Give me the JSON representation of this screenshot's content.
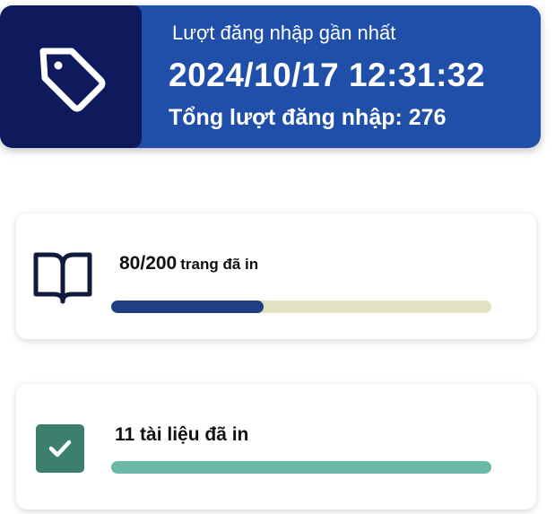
{
  "login": {
    "title": "Lượt đăng nhập gần nhất",
    "datetime": "2024/10/17 12:31:32",
    "count_text": "Tổng lượt đăng nhập: 276",
    "icon": "tag-icon"
  },
  "pages": {
    "value": "80/200",
    "unit": "trang đã in",
    "printed": 80,
    "total": 200,
    "icon": "book-icon"
  },
  "documents": {
    "text": "11 tài liệu đã in",
    "icon": "checkbox-icon"
  },
  "colors": {
    "header_bg": "#1f4fa9",
    "header_icon_bg": "#0f1a5c",
    "progress_fill": "#1f3f85",
    "progress_track": "#e3e3c4",
    "docs_bar": "#6bb8a6",
    "check_bg": "#3c7f6c"
  }
}
